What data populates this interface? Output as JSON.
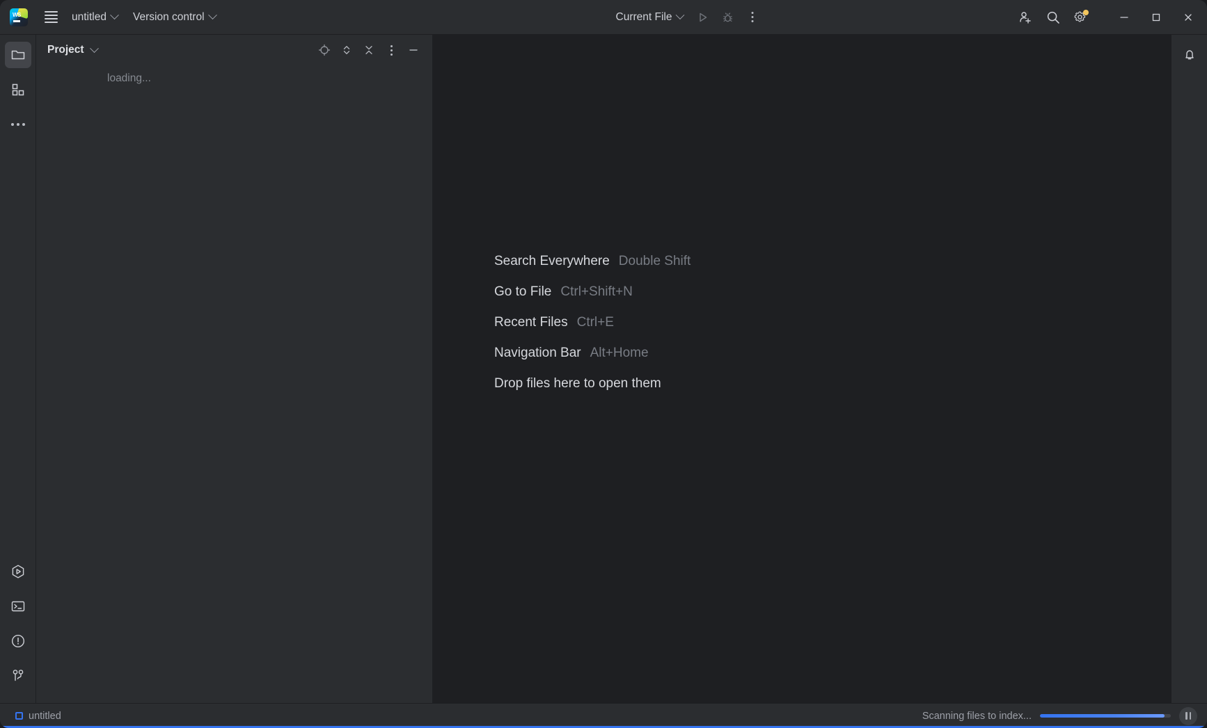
{
  "window": {
    "title": "untitled",
    "app": "WebStorm"
  },
  "titlebar": {
    "logo_text": "WS",
    "menu_icon": "hamburger-icon",
    "project_name": "untitled",
    "vcs_label": "Version control",
    "run_config_label": "Current File",
    "run_icon": "run-icon",
    "debug_icon": "debug-icon",
    "more_icon": "more-vertical-icon",
    "account_icon": "add-user-icon",
    "search_icon": "search-icon",
    "settings_icon": "gear-icon",
    "settings_badge_color": "#f2c55c",
    "minimize_icon": "minimize-icon",
    "maximize_icon": "maximize-icon",
    "close_icon": "close-icon"
  },
  "left_strip": {
    "top_items": [
      {
        "name": "project",
        "icon": "folder-icon",
        "active": true
      },
      {
        "name": "structure",
        "icon": "structure-icon",
        "active": false
      },
      {
        "name": "more-tool-windows",
        "icon": "more-horizontal-icon",
        "active": false
      }
    ],
    "bottom_items": [
      {
        "name": "run",
        "icon": "run-hexagon-icon"
      },
      {
        "name": "terminal",
        "icon": "terminal-icon"
      },
      {
        "name": "problems",
        "icon": "warning-circle-icon"
      },
      {
        "name": "version-control",
        "icon": "branch-icon"
      }
    ]
  },
  "project_panel": {
    "title": "Project",
    "loading_text": "loading...",
    "tools": [
      {
        "name": "select-opened-file",
        "icon": "target-icon"
      },
      {
        "name": "expand-collapse",
        "icon": "expand-collapse-icon"
      },
      {
        "name": "collapse-all",
        "icon": "collapse-all-icon"
      },
      {
        "name": "options",
        "icon": "more-vertical-icon"
      },
      {
        "name": "hide",
        "icon": "minimize-icon"
      }
    ]
  },
  "editor": {
    "shortcuts": [
      {
        "label": "Search Everywhere",
        "shortcut": "Double Shift"
      },
      {
        "label": "Go to File",
        "shortcut": "Ctrl+Shift+N"
      },
      {
        "label": "Recent Files",
        "shortcut": "Ctrl+E"
      },
      {
        "label": "Navigation Bar",
        "shortcut": "Alt+Home"
      }
    ],
    "drop_hint": "Drop files here to open them"
  },
  "right_strip": {
    "items": [
      {
        "name": "notifications",
        "icon": "bell-icon"
      }
    ]
  },
  "statusbar": {
    "module_label": "untitled",
    "module_icon": "module-square-icon",
    "progress_text": "Scanning files to index...",
    "progress_percent": 95,
    "pause_icon": "pause-icon",
    "accent_color": "#3574f0"
  }
}
